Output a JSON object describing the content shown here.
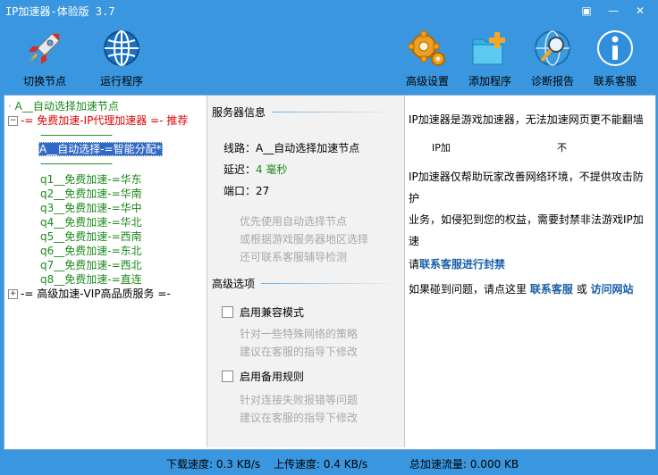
{
  "window": {
    "title": "IP加速器-体验版 3.7"
  },
  "toolbar": {
    "switch_node": "切换节点",
    "run_program": "运行程序",
    "advanced_settings": "高级设置",
    "add_program": "添加程序",
    "diagnose_report": "诊断报告",
    "contact_support": "联系客服"
  },
  "tree": {
    "root_auto": "A__自动选择加速节点",
    "free_group": "-= 免费加速-IP代理加速器 =- 推荐",
    "dashes": "------------------------",
    "selected_auto": "A__自动选择-=智能分配*",
    "nodes": [
      "q1__免费加速-=华东",
      "q2__免费加速-=华南",
      "q3__免费加速-=华中",
      "q4__免费加速-=华北",
      "q5__免费加速-=西南",
      "q6__免费加速-=东北",
      "q7__免费加速-=西北",
      "q8__免费加速-=直连"
    ],
    "vip_group": "-= 高级加速-VIP高品质服务 =-"
  },
  "server_info": {
    "title": "服务器信息",
    "route_label": "线路：",
    "route_value": "A__自动选择加速节点",
    "latency_label": "延迟：",
    "latency_value": "4 毫秒",
    "port_label": "端口：",
    "port_value": "27",
    "hint1": "优先使用自动选择节点",
    "hint2": "或根据游戏服务器地区选择",
    "hint3": "还可联系客服辅导检测"
  },
  "advanced": {
    "title": "高级选项",
    "compat_label": "启用兼容模式",
    "compat_hint1": "针对一些特殊网络的策略",
    "compat_hint2": "建议在客服的指导下修改",
    "backup_label": "启用备用规则",
    "backup_hint1": "针对连接失败报错等问题",
    "backup_hint2": "建议在客服的指导下修改"
  },
  "info": {
    "line1": "IP加速器是游戏加速器，无法加速网页更不能翻墙",
    "line2a": "IP加",
    "line2b": "不",
    "line3": "IP加速器仅帮助玩家改善网络环境，不提供攻击防",
    "line4": "护",
    "line5": "业务，如侵犯到您的权益，需要封禁非法游戏IP加",
    "line6": "速",
    "line7_prefix": "请",
    "line7_link": "联系客服进行封禁",
    "line8_prefix": "如果碰到问题，请点这里",
    "line8_link1": "联系客服",
    "line8_or": "或",
    "line8_link2": "访问网站"
  },
  "status": {
    "download": "下载速度: 0.3 KB/s",
    "upload": "上传速度: 0.4 KB/s",
    "traffic": "总加速流量: 0.000 KB"
  },
  "colors": {
    "frame": "#3a97df",
    "link": "#1960a8",
    "node_green": "#1c8a1c",
    "group_red": "#e00000",
    "selected": "#3169c6"
  }
}
